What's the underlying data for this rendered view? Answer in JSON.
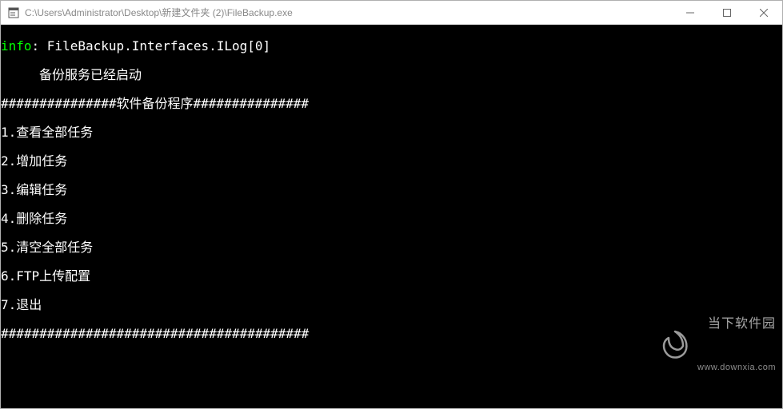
{
  "window": {
    "title": "C:\\Users\\Administrator\\Desktop\\新建文件夹 (2)\\FileBackup.exe"
  },
  "console": {
    "info_label": "info",
    "info_line": ": FileBackup.Interfaces.ILog[0]",
    "service_started": "备份服务已经启动",
    "divider_top": "###############软件备份程序###############",
    "menu": {
      "1": "1.查看全部任务",
      "2": "2.增加任务",
      "3": "3.编辑任务",
      "4": "4.删除任务",
      "5": "5.清空全部任务",
      "6": "6.FTP上传配置",
      "7": "7.退出"
    },
    "divider_bottom": "########################################"
  },
  "watermark": {
    "title": "当下软件园",
    "url": "www.downxia.com"
  }
}
